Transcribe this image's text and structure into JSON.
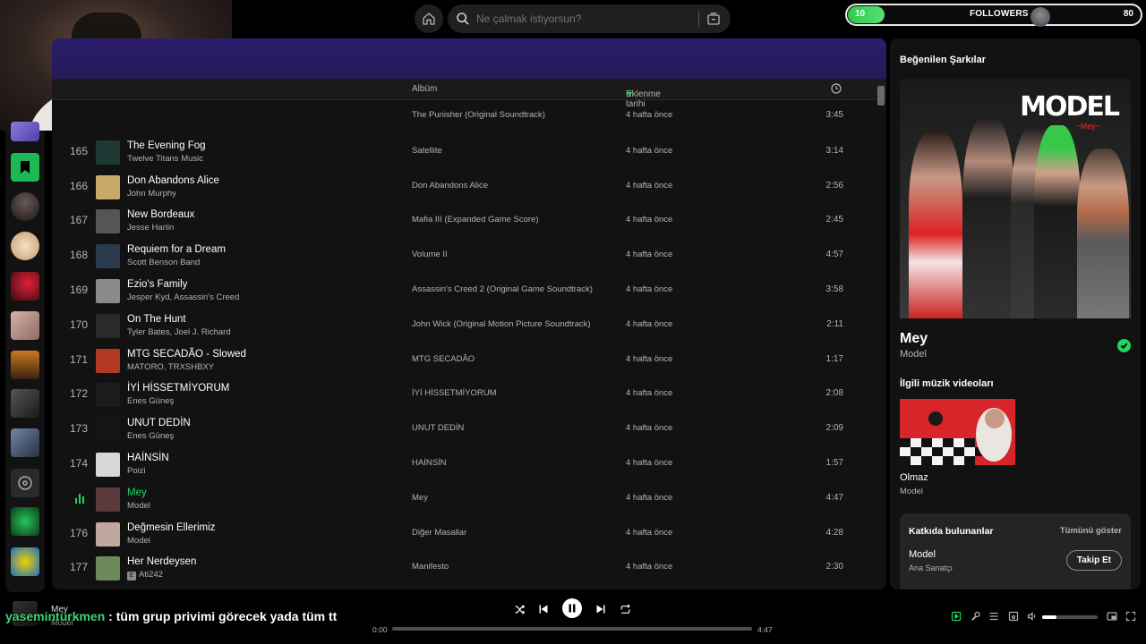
{
  "search": {
    "placeholder": "Ne çalmak istiyorsun?"
  },
  "followers_overlay": {
    "count": "10",
    "label": "FOLLOWERS",
    "goal": "80",
    "progress_fraction": 0.125
  },
  "columns": {
    "album": "Albüm",
    "added": "Eklenme tarihi",
    "duration_icon": "clock-icon"
  },
  "tracks": [
    {
      "num": "",
      "title": "",
      "artist": "",
      "album": "The Punisher (Original Soundtrack)",
      "added": "4 hafta önce",
      "duration": "3:45",
      "art": "#333"
    },
    {
      "num": "165",
      "title": "The Evening Fog",
      "artist": "Twelve Titans Music",
      "album": "Satellite",
      "added": "4 hafta önce",
      "duration": "3:14",
      "art": "#1f3a34"
    },
    {
      "num": "166",
      "title": "Don Abandons Alice",
      "artist": "John Murphy",
      "album": "Don Abandons Alice",
      "added": "4 hafta önce",
      "duration": "2:56",
      "art": "#c9a86a"
    },
    {
      "num": "167",
      "title": "New Bordeaux",
      "artist": "Jesse Harlin",
      "album": "Mafia III (Expanded Game Score)",
      "added": "4 hafta önce",
      "duration": "2:45",
      "art": "#555"
    },
    {
      "num": "168",
      "title": "Requiem for a Dream",
      "artist": "Scott Benson Band",
      "album": "Volume II",
      "added": "4 hafta önce",
      "duration": "4:57",
      "art": "#2b3a4c"
    },
    {
      "num": "169",
      "title": "Ezio's Family",
      "artist": "Jesper Kyd, Assassin's Creed",
      "album": "Assassin's Creed 2 (Original Game Soundtrack)",
      "added": "4 hafta önce",
      "duration": "3:58",
      "art": "#8a8a8a"
    },
    {
      "num": "170",
      "title": "On The Hunt",
      "artist": "Tyler Bates, Joel J. Richard",
      "album": "John Wick (Original Motion Picture Soundtrack)",
      "added": "4 hafta önce",
      "duration": "2:11",
      "art": "#2a2a2a"
    },
    {
      "num": "171",
      "title": "MTG SECADÃO - Slowed",
      "artist": "MATORO, TRXSHBXY",
      "album": "MTG SECADÃO",
      "added": "4 hafta önce",
      "duration": "1:17",
      "art": "#b23a22"
    },
    {
      "num": "172",
      "title": "İYİ HİSSETMİYORUM",
      "artist": "Enes Güneş",
      "album": "İYİ HİSSETMİYORUM",
      "added": "4 hafta önce",
      "duration": "2:08",
      "art": "#1c1c1c"
    },
    {
      "num": "173",
      "title": "UNUT DEDİN",
      "artist": "Enes Güneş",
      "album": "UNUT DEDİN",
      "added": "4 hafta önce",
      "duration": "2:09",
      "art": "#141414"
    },
    {
      "num": "174",
      "title": "HAİNSİN",
      "artist": "Poizi",
      "album": "HAİNSİN",
      "added": "4 hafta önce",
      "duration": "1:57",
      "art": "#d8d8d8"
    },
    {
      "num": "",
      "title": "Mey",
      "artist": "Model",
      "album": "Mey",
      "added": "4 hafta önce",
      "duration": "4:47",
      "art": "#5a3a3a",
      "playing": true
    },
    {
      "num": "176",
      "title": "Değmesin Ellerimiz",
      "artist": "Model",
      "album": "Diğer Masallar",
      "added": "4 hafta önce",
      "duration": "4:28",
      "art": "#c0a8a0"
    },
    {
      "num": "177",
      "title": "Her Nerdeysen",
      "artist": "Ati242",
      "album": "Manifesto",
      "added": "4 hafta önce",
      "duration": "2:30",
      "art": "#6f8a5a",
      "explicit": "E"
    }
  ],
  "right_panel": {
    "title": "Beğenilen Şarkılar",
    "cover_logo": "MODEL",
    "cover_sub": "~Mey~",
    "song": "Mey",
    "artist": "Model",
    "videos_title": "İlgili müzik videoları",
    "video": {
      "title": "Olmaz",
      "artist": "Model"
    },
    "credits": {
      "title": "Katkıda bulunanlar",
      "show_all": "Tümünü göster",
      "name": "Model",
      "role": "Ana Sanatçı",
      "follow": "Takip Et"
    }
  },
  "now_playing": {
    "title": "Mey",
    "artist": "Model"
  },
  "chat": {
    "user": "yasemintürkmen",
    "message": ": tüm grup privimi görecek yada tüm tt"
  },
  "player": {
    "current": "0:00",
    "total": "4:47",
    "progress_fraction": 0.0,
    "volume_fraction": 0.25
  },
  "colors": {
    "accent": "#1ed760",
    "banner": "#2b1d6b",
    "panel": "#121212"
  }
}
